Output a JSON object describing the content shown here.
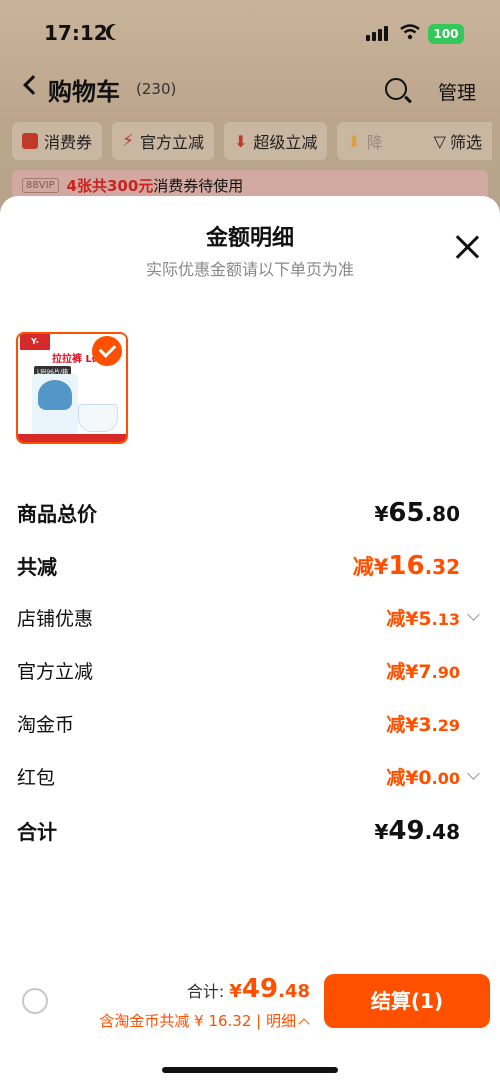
{
  "status_bar": {
    "time": "17:12",
    "battery": "100"
  },
  "nav": {
    "title": "购物车",
    "count": "(230)",
    "manage": "管理"
  },
  "filters": [
    {
      "label": "消费券",
      "icon": "coupon-icon"
    },
    {
      "label": "官方立减",
      "icon": "bolt-icon"
    },
    {
      "label": "超级立减",
      "icon": "arrow-down-icon"
    },
    {
      "label": "降",
      "icon": "arrow-down-icon"
    }
  ],
  "filter_btn": "筛选",
  "coupon_banner": {
    "vip": "88VIP",
    "strong": "4张共300元",
    "rest": "消费券待使用"
  },
  "sheet": {
    "title": "金额明细",
    "subtitle": "实际优惠金额请以下单页为准",
    "product": {
      "logo": "Y-BEST",
      "name": "拉拉裤 L码",
      "pack": "L码96片/箱"
    },
    "rows": {
      "total_price": {
        "label": "商品总价",
        "yen": "¥",
        "int": "65",
        "dec": ".80"
      },
      "total_reduce": {
        "label": "共减",
        "prefix": "减¥",
        "int": "16",
        "dec": ".32"
      },
      "shop_discount": {
        "label": "店铺优惠",
        "prefix": "减¥",
        "int": "5",
        "dec": ".13"
      },
      "official": {
        "label": "官方立减",
        "prefix": "减¥",
        "int": "7",
        "dec": ".90"
      },
      "coins": {
        "label": "淘金币",
        "prefix": "减¥",
        "int": "3",
        "dec": ".29"
      },
      "red_packet": {
        "label": "红包",
        "prefix": "减¥",
        "int": "0",
        "dec": ".00"
      },
      "sum": {
        "label": "合计",
        "yen": "¥",
        "int": "49",
        "dec": ".48"
      }
    }
  },
  "bottom": {
    "total_label": "合计: ",
    "total_yen": "¥",
    "total_int": "49",
    "total_dec": ".48",
    "detail_prefix": "含淘金币共减 ¥ 16.32",
    "detail_sep": " | ",
    "detail_toggle": "明细",
    "checkout": "结算(1)"
  },
  "colors": {
    "accent": "#ff5000"
  }
}
